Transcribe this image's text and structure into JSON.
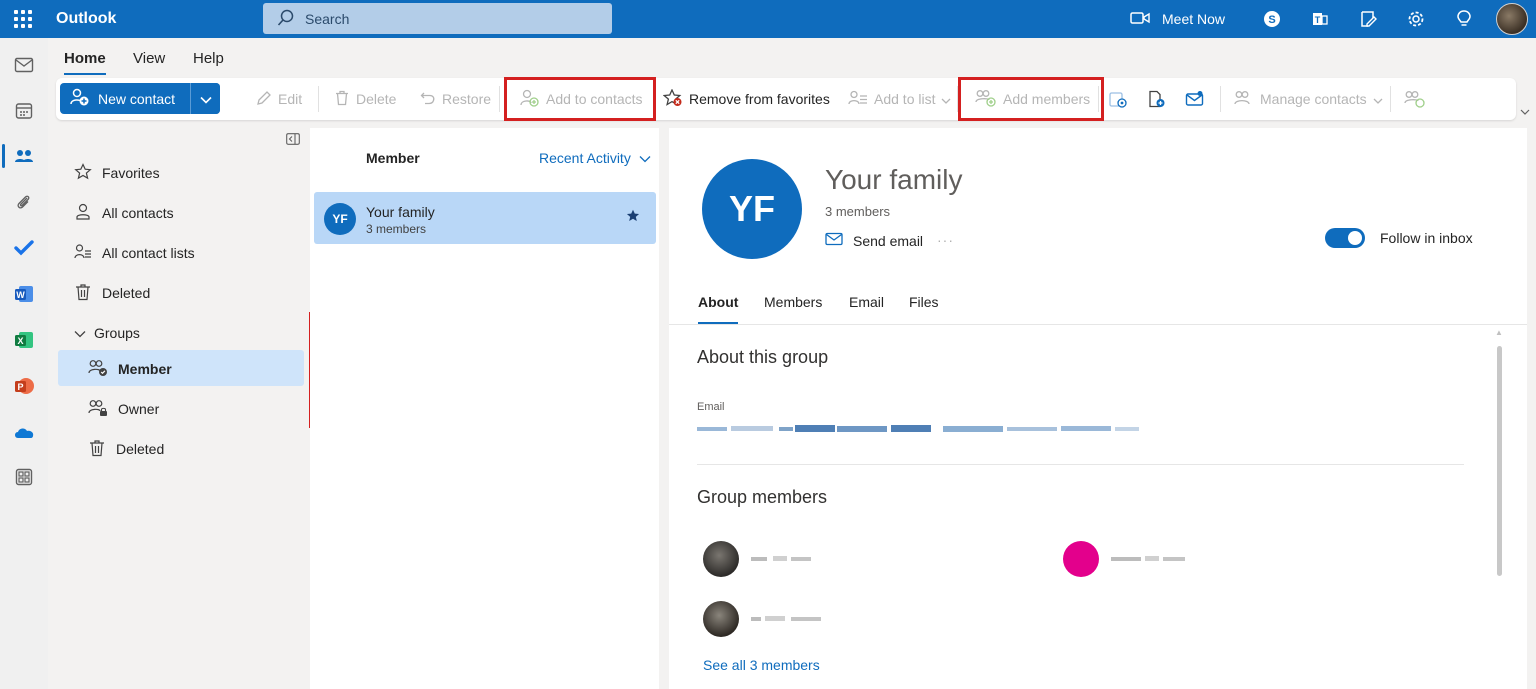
{
  "app": {
    "title": "Outlook",
    "search_placeholder": "Search",
    "meet_now": "Meet Now"
  },
  "tabs": [
    "Home",
    "View",
    "Help"
  ],
  "ribbon": {
    "new_contact": "New contact",
    "edit": "Edit",
    "delete": "Delete",
    "restore": "Restore",
    "add_to_contacts": "Add to contacts",
    "remove_from_favorites": "Remove from favorites",
    "add_to_list": "Add to list",
    "add_members": "Add members",
    "manage_contacts": "Manage contacts"
  },
  "nav": {
    "favorites": "Favorites",
    "all_contacts": "All contacts",
    "all_contact_lists": "All contact lists",
    "deleted": "Deleted",
    "groups": "Groups",
    "member": "Member",
    "owner": "Owner",
    "groups_deleted": "Deleted"
  },
  "list": {
    "header": "Member",
    "sort": "Recent Activity",
    "items": [
      {
        "initials": "YF",
        "name": "Your family",
        "sub": "3 members",
        "favorite": true
      }
    ]
  },
  "detail": {
    "initials": "YF",
    "name": "Your family",
    "member_count": "3 members",
    "send_email": "Send email",
    "more": "···",
    "follow_label": "Follow in inbox",
    "follow_on": true,
    "tabs": [
      "About",
      "Members",
      "Email",
      "Files"
    ],
    "about_title": "About this group",
    "email_label": "Email",
    "members_title": "Group members",
    "see_all": "See all 3 members"
  },
  "colors": {
    "brand": "#0f6cbd",
    "highlight_box": "#d42020",
    "selected_bg": "#cfe4fa"
  },
  "icons": {
    "rail": [
      "mail-icon",
      "calendar-icon",
      "people-icon",
      "attachment-icon",
      "todo-icon",
      "word-icon",
      "excel-icon",
      "powerpoint-icon",
      "onedrive-icon",
      "more-apps-icon"
    ],
    "topbar": [
      "video-icon",
      "skype-icon",
      "teams-icon",
      "feedback-icon",
      "settings-icon",
      "tips-icon"
    ]
  }
}
